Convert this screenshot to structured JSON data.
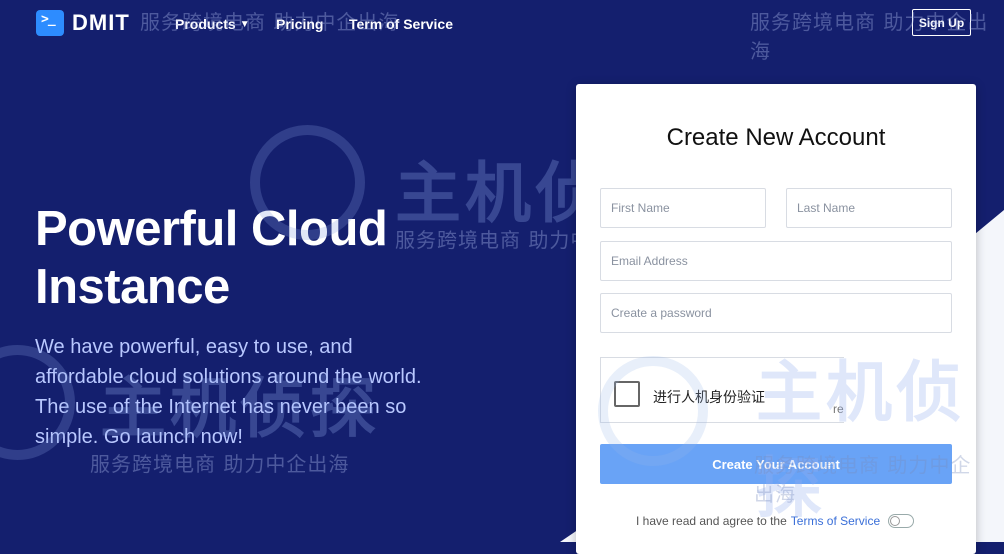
{
  "nav": {
    "logo_glyph": ">_",
    "brand": "DMIT",
    "links": [
      {
        "label": "Products",
        "has_dropdown": true,
        "icon": "chevron-down-icon"
      },
      {
        "label": "Pricing"
      },
      {
        "label": "Term of Service"
      }
    ],
    "signup_label": "Sign Up"
  },
  "hero": {
    "title": "Powerful Cloud Instance",
    "subtitle": "We have powerful, easy to use, and affordable cloud solutions around the world. The use of the Internet has never been so simple. Go launch now!"
  },
  "form": {
    "title": "Create New Account",
    "first_name_placeholder": "First Name",
    "last_name_placeholder": "Last Name",
    "email_placeholder": "Email Address",
    "password_placeholder": "Create a password",
    "captcha_label": "进行人机身份验证",
    "captcha_tail": "re",
    "submit_label": "Create Your Account",
    "agree_text": "I have read and agree to the",
    "tos_link": "Terms of Service"
  },
  "watermark": {
    "brand_text": "主机侦探",
    "slogan": "服务跨境电商  助力中企出海"
  },
  "colors": {
    "background": "#141f6e",
    "accent": "#2d8cff",
    "button": "#69a3f6",
    "subtitle": "#b9c8ff"
  }
}
